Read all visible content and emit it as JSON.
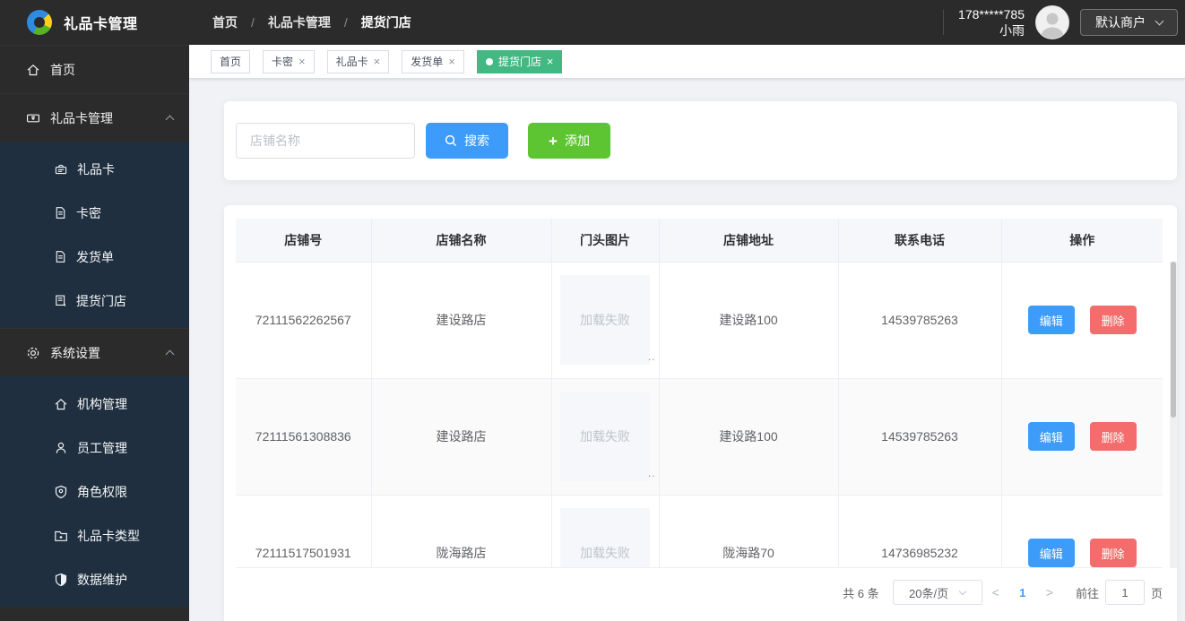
{
  "topbar": {
    "app_title": "礼品卡管理",
    "breadcrumb": [
      "首页",
      "礼品卡管理",
      "提货门店"
    ],
    "breadcrumb_separator": "/",
    "user": {
      "phone": "178*****785",
      "name": "小雨"
    },
    "merchant_label": "默认商户"
  },
  "sidebar": {
    "items": [
      {
        "label": "首页",
        "icon": "home-icon"
      },
      {
        "label": "礼品卡管理",
        "icon": "ticket-icon",
        "expanded": true,
        "children": [
          {
            "label": "礼品卡",
            "icon": "gift-sign-icon"
          },
          {
            "label": "卡密",
            "icon": "document-icon"
          },
          {
            "label": "发货单",
            "icon": "document-icon"
          },
          {
            "label": "提货门店",
            "icon": "store-icon"
          }
        ]
      },
      {
        "label": "系统设置",
        "icon": "gear-icon",
        "expanded": true,
        "children": [
          {
            "label": "机构管理",
            "icon": "building-icon"
          },
          {
            "label": "员工管理",
            "icon": "user-icon"
          },
          {
            "label": "角色权限",
            "icon": "shield-check-icon"
          },
          {
            "label": "礼品卡类型",
            "icon": "folder-icon"
          },
          {
            "label": "数据维护",
            "icon": "shield-icon"
          }
        ]
      }
    ]
  },
  "tabs": [
    {
      "label": "首页",
      "closable": false,
      "active": false
    },
    {
      "label": "卡密",
      "closable": true,
      "active": false
    },
    {
      "label": "礼品卡",
      "closable": true,
      "active": false
    },
    {
      "label": "发货单",
      "closable": true,
      "active": false
    },
    {
      "label": "提货门店",
      "closable": true,
      "active": true
    }
  ],
  "icons": {
    "close": "×",
    "prev": "<",
    "next": ">",
    "plus": "+"
  },
  "search": {
    "placeholder": "店铺名称",
    "search_label": "搜索",
    "add_label": "添加"
  },
  "table": {
    "headers": [
      "店铺号",
      "店铺名称",
      "门头图片",
      "店铺地址",
      "联系电话",
      "操作"
    ],
    "image_error_text": "加载失败",
    "image_overflow_dots": "..",
    "actions": {
      "edit": "编辑",
      "delete": "删除"
    },
    "rows": [
      {
        "shop_id": "72111562262567",
        "shop_name": "建设路店",
        "address": "建设路100",
        "phone": "14539785263"
      },
      {
        "shop_id": "72111561308836",
        "shop_name": "建设路店",
        "address": "建设路100",
        "phone": "14539785263"
      },
      {
        "shop_id": "72111517501931",
        "shop_name": "陇海路店",
        "address": "陇海路70",
        "phone": "14736985232"
      }
    ]
  },
  "pagination": {
    "total_label": "共 6 条",
    "page_size": "20条/页",
    "current_page": "1",
    "goto_label": "前往",
    "goto_value": "1",
    "page_unit": "页"
  },
  "colors": {
    "primary_blue": "#3d9cfa",
    "add_green": "#5dc532",
    "active_tab_green": "#42b983",
    "danger_red": "#f56c6c",
    "topbar_dark": "#2b2b2b",
    "submenu_navy": "#202f3f"
  }
}
